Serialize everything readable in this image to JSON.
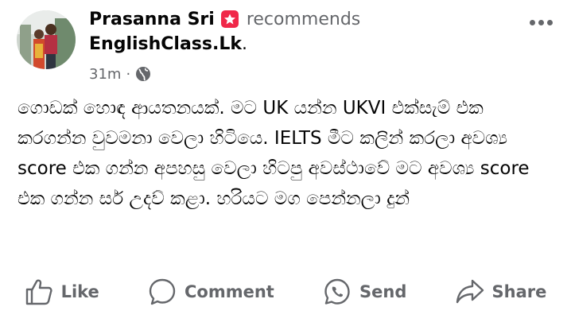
{
  "post": {
    "author": "Prasanna Sri",
    "action_text": "recommends",
    "page_name": "EnglishClass.Lk",
    "page_name_suffix": ".",
    "time": "31m",
    "separator": "·",
    "audience_icon": "globe-icon",
    "recommend_icon": "star-icon",
    "body": "ගොඩක් හොඳ ආයතනයක්. මට UK යන්න UKVI එක්සැම් එක කරගන්න වුවමනා වෙලා හිටියෙ. IELTS මීට කලින් කරලා අවශ්‍ය score එක ගන්න අපහසු වෙලා හිටපු අවස්ථාවේ මට අවශ්‍ය score එක ගන්න සර් උදව් කළා. හරියට මග පෙන්නලා දුන්"
  },
  "actions": {
    "like": "Like",
    "comment": "Comment",
    "send": "Send",
    "share": "Share"
  },
  "colors": {
    "secondary_text": "#65676b",
    "primary_text": "#050505",
    "recommend_red": "#f02849"
  }
}
